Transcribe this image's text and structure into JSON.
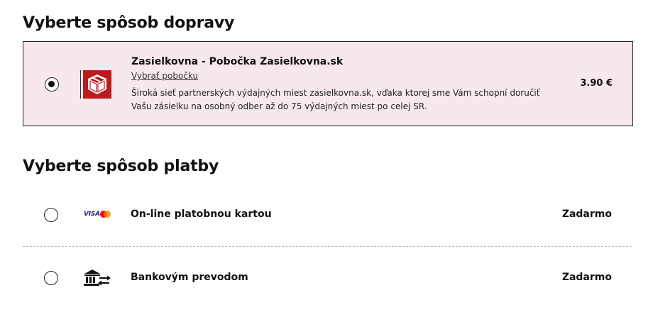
{
  "shipping": {
    "title": "Vyberte spôsob dopravy",
    "option": {
      "selected": true,
      "logo_icon": "zasielkovna-logo-icon",
      "name": "Zasielkovna - Pobočka Zasielkovna.sk",
      "link_label": "Vybrať pobočku",
      "description": "Široká sieť partnerských výdajných miest zasielkovna.sk, vďaka ktorej sme Vám schopní doručiť Vašu zásielku na osobný odber až do 75 výdajných miest po celej SR.",
      "price": "3.90 €",
      "background_color": "#f6e8ee",
      "logo_color": "#ba1b1d"
    }
  },
  "payment": {
    "title": "Vyberte spôsob platby",
    "options": [
      {
        "selected": false,
        "icon": "visa-mastercard-icon",
        "icon_text": "VISA",
        "label": "On-line platobnou kartou",
        "price": "Zadarmo"
      },
      {
        "selected": false,
        "icon": "bank-transfer-icon",
        "label": "Bankovým prevodom",
        "price": "Zadarmo"
      }
    ]
  }
}
